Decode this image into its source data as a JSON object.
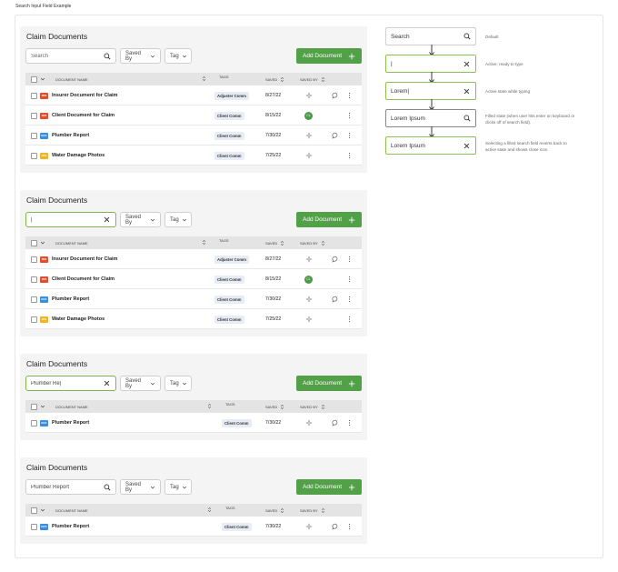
{
  "page_title": "Search Input Field Example",
  "panels": [
    {
      "title": "Claim Documents",
      "search": {
        "value": "",
        "placeholder": "Search",
        "state": "default",
        "icon": "search-icon"
      },
      "saved_by": "Saved By",
      "tag": "Tag",
      "add_button": "Add Document",
      "headers": {
        "name": "DOCUMENT NAME",
        "tags": "TAGS",
        "saved": "SAVED",
        "saved_by": "SAVED BY"
      },
      "rows": [
        {
          "type": "PDF",
          "type_color": "#e04e2b",
          "name": "Insurer Document for Claim",
          "tag": "Adjuster Comm",
          "date": "8/27/22",
          "saved_by": "icon",
          "comment": true,
          "menu": true
        },
        {
          "type": "PDF",
          "type_color": "#e04e2b",
          "name": "Client Document for Claim",
          "tag": "Client Comm",
          "date": "8/15/22",
          "saved_by": "avatar",
          "avatar_text": "CL",
          "comment": false,
          "menu": true
        },
        {
          "type": "DOC",
          "type_color": "#3b8de0",
          "name": "Plumber Report",
          "tag": "Client Comm",
          "date": "7/30/22",
          "saved_by": "icon",
          "comment": true,
          "menu": true
        },
        {
          "type": "JPG",
          "type_color": "#f0b526",
          "name": "Water Damage Photos",
          "tag": "Client Comm",
          "date": "7/25/22",
          "saved_by": "icon",
          "comment": false,
          "menu": true
        }
      ]
    },
    {
      "title": "Claim Documents",
      "search": {
        "value": "|",
        "placeholder": "",
        "state": "active",
        "icon": "close-icon"
      },
      "saved_by": "Saved By",
      "tag": "Tag",
      "add_button": "Add Document",
      "headers": {
        "name": "DOCUMENT NAME",
        "tags": "TAGS",
        "saved": "SAVED",
        "saved_by": "SAVED BY"
      },
      "rows": [
        {
          "type": "PDF",
          "type_color": "#e04e2b",
          "name": "Insurer Document for Claim",
          "tag": "Adjuster Comm",
          "date": "8/27/22",
          "saved_by": "icon",
          "comment": true,
          "menu": true
        },
        {
          "type": "PDF",
          "type_color": "#e04e2b",
          "name": "Client Document for Claim",
          "tag": "Client Comm",
          "date": "8/15/22",
          "saved_by": "avatar",
          "avatar_text": "CL",
          "comment": false,
          "menu": true
        },
        {
          "type": "DOC",
          "type_color": "#3b8de0",
          "name": "Plumber Report",
          "tag": "Client Comm",
          "date": "7/30/22",
          "saved_by": "icon",
          "comment": true,
          "menu": true
        },
        {
          "type": "JPG",
          "type_color": "#f0b526",
          "name": "Water Damage Photos",
          "tag": "Client Comm",
          "date": "7/25/22",
          "saved_by": "icon",
          "comment": false,
          "menu": true
        }
      ]
    },
    {
      "title": "Claim Documents",
      "search": {
        "value": "Plumber Re|",
        "placeholder": "",
        "state": "active",
        "icon": "close-icon"
      },
      "saved_by": "Saved By",
      "tag": "Tag",
      "add_button": "Add Document",
      "headers": {
        "name": "DOCUMENT NAME",
        "tags": "TAGS",
        "saved": "SAVED",
        "saved_by": "SAVED BY"
      },
      "rows": [
        {
          "type": "DOC",
          "type_color": "#3b8de0",
          "name": "Plumber Report",
          "tag": "Client Comm",
          "date": "7/30/22",
          "saved_by": "icon",
          "comment": true,
          "menu": true
        }
      ]
    },
    {
      "title": "Claim Documents",
      "search": {
        "value": "Plumber Report",
        "placeholder": "",
        "state": "filled",
        "icon": "search-icon"
      },
      "saved_by": "Saved By",
      "tag": "Tag",
      "add_button": "Add Document",
      "headers": {
        "name": "DOCUMENT NAME",
        "tags": "TAGS",
        "saved": "SAVED",
        "saved_by": "SAVED BY"
      },
      "rows": [
        {
          "type": "DOC",
          "type_color": "#3b8de0",
          "name": "Plumber Report",
          "tag": "Client Comm",
          "date": "7/30/22",
          "saved_by": "icon",
          "comment": true,
          "menu": true
        }
      ]
    }
  ],
  "states": [
    {
      "value": "Search",
      "icon": "search-icon",
      "style": "default",
      "note": "Default"
    },
    {
      "value": "|",
      "icon": "close-icon",
      "style": "active",
      "note": "Active; ready to type"
    },
    {
      "value": "Lorem|",
      "icon": "close-icon",
      "style": "active",
      "note": "Active state while typing"
    },
    {
      "value": "Lorem Ipsum",
      "icon": "search-icon",
      "style": "filled",
      "note": "Filled state (when user hits enter on keyboard or clicks off of search field)."
    },
    {
      "value": "Lorem Ipsum",
      "icon": "close-icon",
      "style": "active",
      "note": "Selecting a filled search field  reverts back to active state and shows close icon."
    }
  ],
  "colors": {
    "accent": "#52a048",
    "active_border": "#8cc04f",
    "pdf": "#e04e2b",
    "doc": "#3b8de0",
    "jpg": "#f0b526"
  }
}
